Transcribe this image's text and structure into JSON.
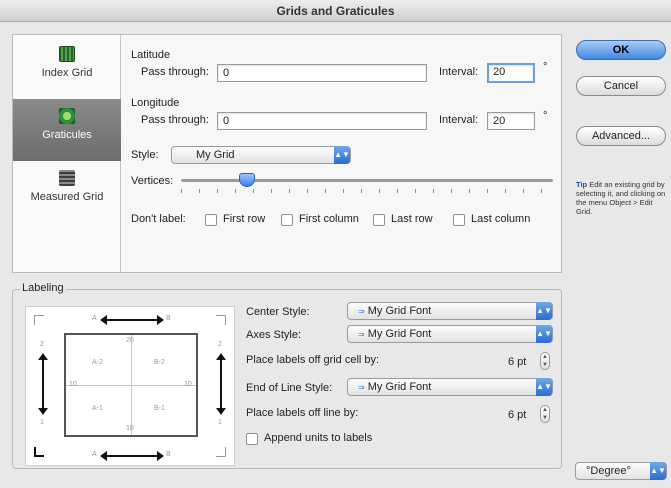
{
  "window": {
    "title": "Grids and Graticules"
  },
  "sidebar": {
    "items": [
      {
        "label": "Index Grid",
        "icon": "index-grid-icon"
      },
      {
        "label": "Graticules",
        "icon": "graticules-icon",
        "selected": true
      },
      {
        "label": "Measured Grid",
        "icon": "measured-grid-icon"
      }
    ]
  },
  "latitude": {
    "heading": "Latitude",
    "pass_label": "Pass through:",
    "pass_value": "0",
    "interval_label": "Interval:",
    "interval_value": "20",
    "unit": "°"
  },
  "longitude": {
    "heading": "Longitude",
    "pass_label": "Pass through:",
    "pass_value": "0",
    "interval_label": "Interval:",
    "interval_value": "20",
    "unit": "°"
  },
  "style": {
    "label": "Style:",
    "value": "My Grid"
  },
  "vertices": {
    "label": "Vertices:",
    "level_fraction": 0.18
  },
  "dont_label": {
    "label": "Don't label:",
    "options": [
      "First row",
      "First column",
      "Last row",
      "Last column"
    ]
  },
  "buttons": {
    "ok": "OK",
    "cancel": "Cancel",
    "advanced": "Advanced..."
  },
  "tip": {
    "prefix": "Tip",
    "text": " Edit an existing grid by selecting it, and clicking on the menu Object > Edit Grid."
  },
  "labeling": {
    "title": "Labeling",
    "center_style_label": "Center Style:",
    "center_style_value": "My Grid Font",
    "axes_style_label": "Axes Style:",
    "axes_style_value": "My Grid Font",
    "offset_cell_label": "Place labels off grid cell by:",
    "offset_cell_value": "6 pt",
    "end_line_label": "End of Line Style:",
    "end_line_value": "My Grid Font",
    "offset_line_label": "Place labels off line by:",
    "offset_line_value": "6 pt",
    "append_units_label": "Append units to labels",
    "diagram": {
      "top_left": "A",
      "top_right": "B",
      "bottom_left": "A",
      "bottom_right": "B",
      "left_top": "2",
      "left_bottom": "1",
      "right_top": "2",
      "right_bottom": "1",
      "cell_top": "20",
      "cell_bottom": "10",
      "cell_left": "10",
      "cell_right": "10",
      "q1": "A-2",
      "q2": "B-2",
      "q3": "A-1",
      "q4": "B-1"
    }
  },
  "units_popup": {
    "value": "°Degree°"
  }
}
